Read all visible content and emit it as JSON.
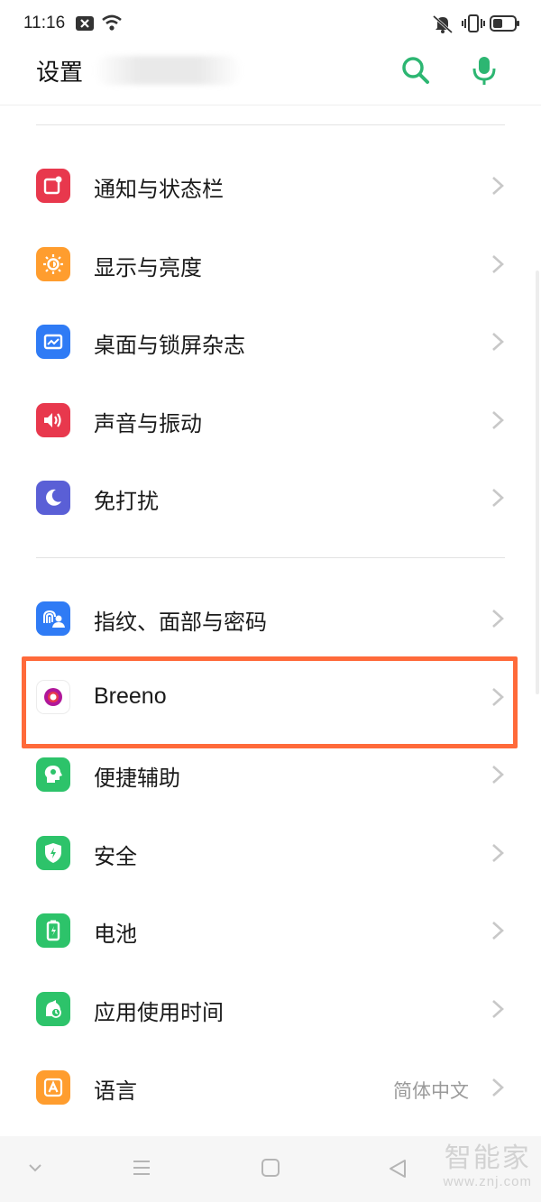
{
  "status_bar": {
    "time": "11:16",
    "icons": [
      "notification-x-icon",
      "wifi-icon",
      "mute-icon",
      "vibrate-icon",
      "battery-icon"
    ]
  },
  "header": {
    "title": "设置",
    "actions": [
      "search-icon",
      "mic-icon"
    ],
    "accent": "#2db672"
  },
  "sections": [
    {
      "items": [
        {
          "label": "通知与状态栏",
          "icon": "notification-icon",
          "color": "#e8384d"
        },
        {
          "label": "显示与亮度",
          "icon": "brightness-icon",
          "color": "#ff9d2e"
        },
        {
          "label": "桌面与锁屏杂志",
          "icon": "wallpaper-icon",
          "color": "#2f7bf5"
        },
        {
          "label": "声音与振动",
          "icon": "volume-icon",
          "color": "#e8384d"
        },
        {
          "label": "免打扰",
          "icon": "moon-icon",
          "color": "#5a5fd6"
        }
      ]
    },
    {
      "items": [
        {
          "label": "指纹、面部与密码",
          "icon": "fingerprint-face-icon",
          "color": "#2f7bf5"
        },
        {
          "label": "Breeno",
          "icon": "breeno-icon",
          "color": "#b0179a",
          "highlighted": true
        },
        {
          "label": "便捷辅助",
          "icon": "assist-icon",
          "color": "#2dc36a"
        },
        {
          "label": "安全",
          "icon": "shield-icon",
          "color": "#2dc36a"
        },
        {
          "label": "电池",
          "icon": "battery-charge-icon",
          "color": "#2dc36a"
        },
        {
          "label": "应用使用时间",
          "icon": "app-time-icon",
          "color": "#2dc36a"
        },
        {
          "label": "语言",
          "icon": "language-icon",
          "color": "#ff9d2e",
          "value": "简体中文"
        }
      ]
    }
  ],
  "highlight_color": "#ff6a3a",
  "nav_bar": {
    "buttons": [
      "collapse-icon",
      "menu-icon",
      "home-icon",
      "back-icon"
    ]
  },
  "watermark": {
    "main": "智能家",
    "url": "www.znj.com"
  }
}
